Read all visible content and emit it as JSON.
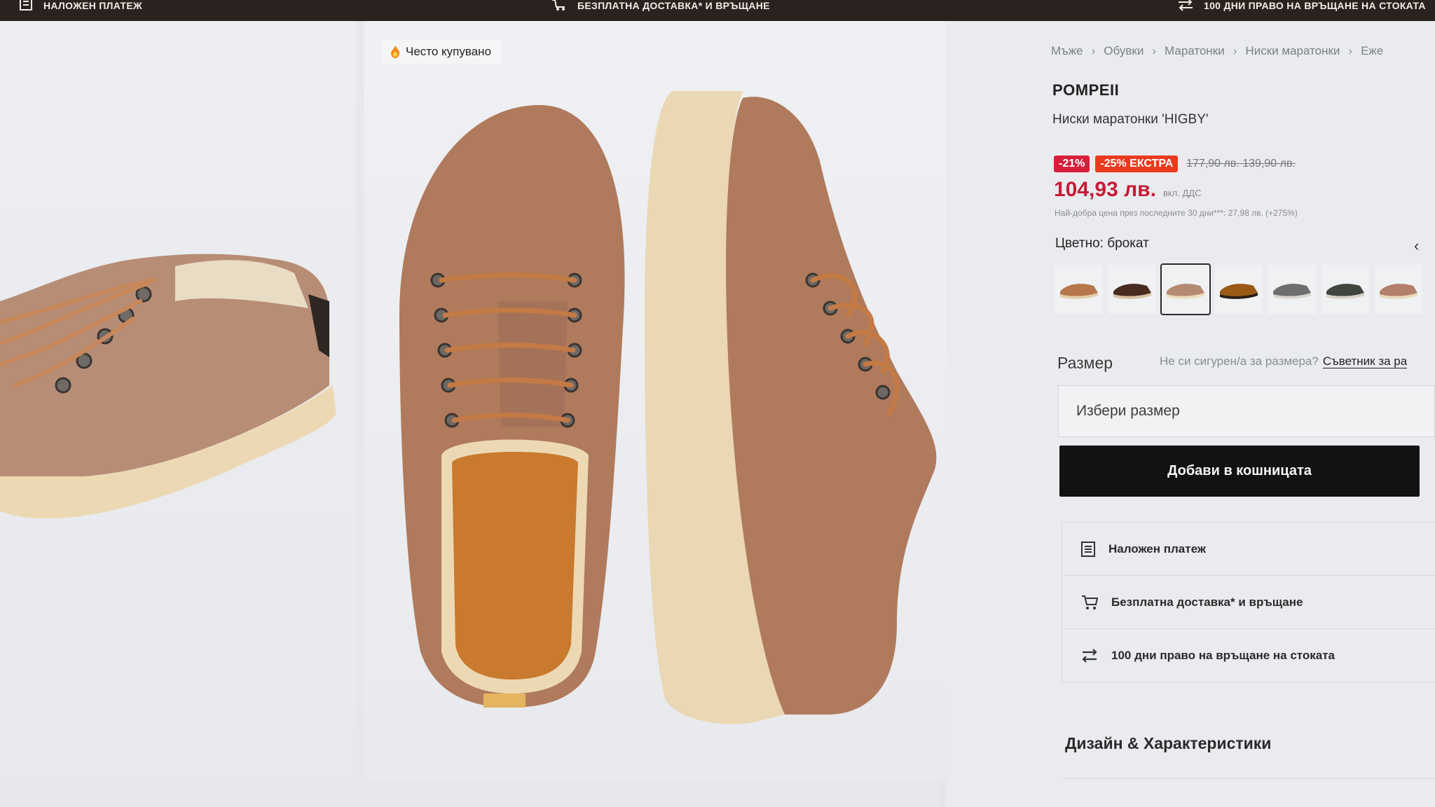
{
  "topbar": {
    "item1": "НАЛОЖЕН ПЛАТЕЖ",
    "item2": "БЕЗПЛАТНА ДОСТАВКА* И ВРЪЩАНЕ",
    "item3": "100 ДНИ ПРАВО НА ВРЪЩАНЕ НА СТОКАТА"
  },
  "gallery": {
    "badge": "Често купувано"
  },
  "breadcrumb": [
    "Мъже",
    "Обувки",
    "Маратонки",
    "Ниски маратонки",
    "Еже"
  ],
  "product": {
    "brand": "POMPEII",
    "name": "Ниски маратонки 'HIGBY'",
    "discount": "-21%",
    "extra_discount": "-25% ЕКСТРА",
    "old_prices": "177,90 лв. 139,90 лв.",
    "price": "104,93 лв.",
    "vat": "вкл. ДДС",
    "lowest_price_note": "Най-добра цена през последните 30 дни***: 27,98 лв. (+275%)",
    "color_label": "Цветно: брокат",
    "swatches": [
      "tan",
      "dark-brown",
      "sand",
      "cognac",
      "grey",
      "dark-olive",
      "light-tan"
    ],
    "size_label": "Размер",
    "size_help": "Не си сигурен/а за размера?",
    "size_link": "Съветник за ра",
    "size_placeholder": "Избери размер",
    "add_to_cart": "Добави в кошницата"
  },
  "benefits": [
    {
      "icon": "invoice-icon",
      "label": "Наложен платеж"
    },
    {
      "icon": "cart-icon",
      "label": "Безплатна доставка* и връщане"
    },
    {
      "icon": "return-icon",
      "label": "100 дни право на връщане на стоката"
    }
  ],
  "section_title": "Дизайн & Характеристики",
  "colors": {
    "sale": "#d81e3a",
    "extra": "#ea3a1e",
    "price": "#c71b36",
    "button": "#121212"
  }
}
